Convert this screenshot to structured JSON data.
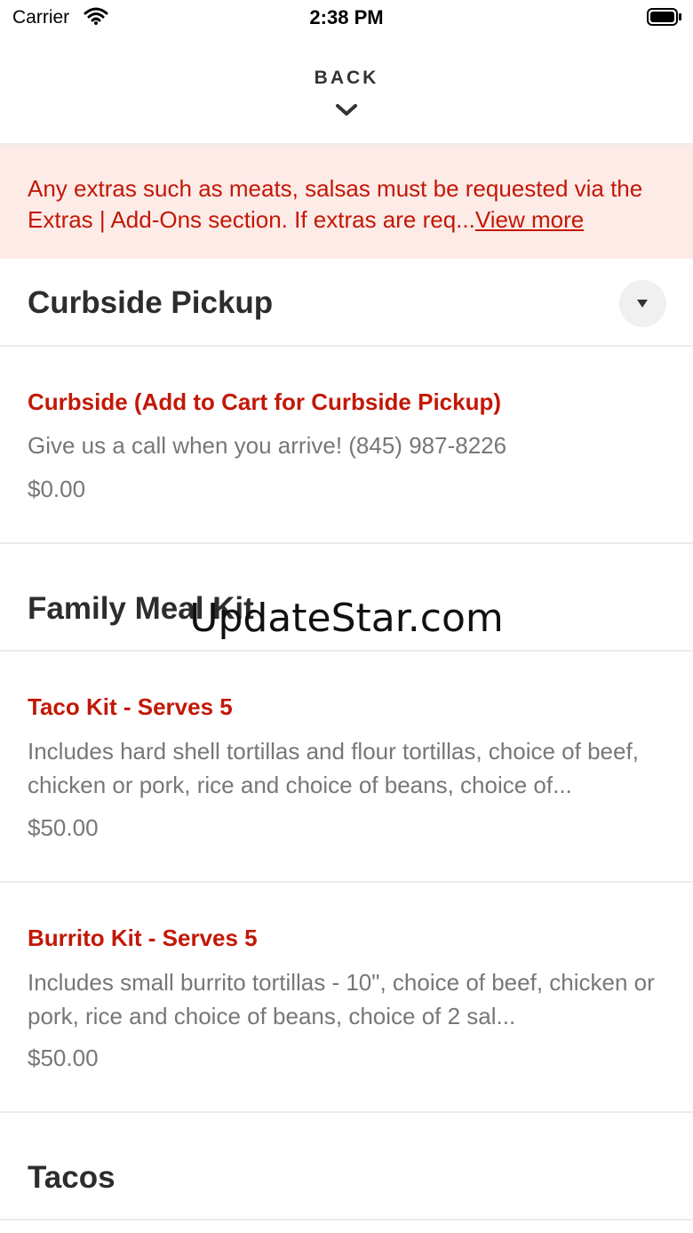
{
  "status_bar": {
    "carrier": "Carrier",
    "time": "2:38 PM"
  },
  "nav": {
    "back_label": "BACK"
  },
  "notice": {
    "text": "Any extras such as meats, salsas must be requested via the Extras | Add-Ons section. If extras are req...",
    "link": "View more"
  },
  "sections": [
    {
      "title": "Curbside Pickup",
      "items": [
        {
          "name": "Curbside (Add to Cart for Curbside Pickup)",
          "desc": "Give us a call when you arrive! (845) 987-8226",
          "price": "$0.00"
        }
      ]
    },
    {
      "title": "Family Meal Kit",
      "items": [
        {
          "name": "Taco Kit - Serves 5",
          "desc": "Includes hard shell tortillas and flour tortillas, choice of beef, chicken or pork, rice and choice of beans, choice of...",
          "price": "$50.00"
        },
        {
          "name": "Burrito Kit - Serves 5",
          "desc": "Includes small burrito tortillas - 10\", choice of beef, chicken or pork, rice and choice of beans, choice of 2 sal...",
          "price": "$50.00"
        }
      ]
    },
    {
      "title": "Tacos",
      "items": []
    }
  ],
  "watermark": "UpdateStar.com",
  "colors": {
    "accent": "#c21807",
    "notice_bg": "#fdebe7"
  }
}
